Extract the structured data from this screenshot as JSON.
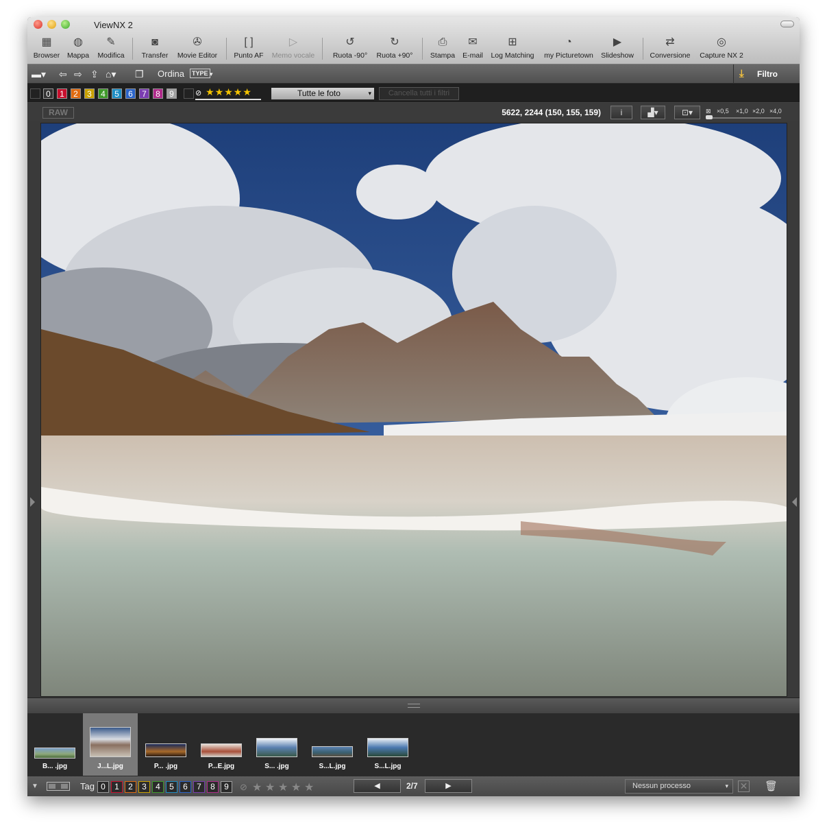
{
  "window": {
    "title": "ViewNX 2"
  },
  "toolbar": {
    "items": [
      {
        "label": "Browser",
        "icon": "browser-icon"
      },
      {
        "label": "Mappa",
        "icon": "globe-icon"
      },
      {
        "label": "Modifica",
        "icon": "edit-icon"
      },
      {
        "label": "Transfer",
        "icon": "camera-icon"
      },
      {
        "label": "Movie Editor",
        "icon": "film-reel-icon"
      },
      {
        "label": "Punto AF",
        "icon": "af-point-icon"
      },
      {
        "label": "Memo vocale",
        "icon": "voice-memo-icon",
        "disabled": true
      },
      {
        "label": "Ruota -90°",
        "icon": "rotate-left-icon"
      },
      {
        "label": "Ruota +90°",
        "icon": "rotate-right-icon"
      },
      {
        "label": "Stampa",
        "icon": "print-icon"
      },
      {
        "label": "E-mail",
        "icon": "mail-icon"
      },
      {
        "label": "Log Matching",
        "icon": "log-matching-icon"
      },
      {
        "label": "my Picturetown",
        "icon": "picturetown-icon"
      },
      {
        "label": "Slideshow",
        "icon": "slideshow-icon"
      },
      {
        "label": "Conversione",
        "icon": "convert-icon"
      },
      {
        "label": "Capture NX 2",
        "icon": "capture-nx-icon"
      }
    ]
  },
  "navbar": {
    "sort_label": "Ordina",
    "sort_type": "TYPE",
    "filter_label": "Filtro"
  },
  "filterbar": {
    "labels": [
      "0",
      "1",
      "2",
      "3",
      "4",
      "5",
      "6",
      "7",
      "8",
      "9"
    ],
    "label_colors": [
      "#333333",
      "#c8102e",
      "#e06a10",
      "#c9a100",
      "#3f9a2a",
      "#1e8ec4",
      "#2a63c8",
      "#7a3cb0",
      "#b02a8a",
      "#a0a0a0"
    ],
    "stars": "★★★★★",
    "dropdown_value": "Tutte le foto",
    "clear_button": "Cancella tutti i filtri"
  },
  "infobar": {
    "raw_badge": "RAW",
    "coords": "5622, 2244 (150, 155, 159)",
    "zoom_levels": [
      "×0,5",
      "×1,0",
      "×2,0",
      "×4,0"
    ]
  },
  "filmstrip": {
    "items": [
      {
        "label": "B... .jpg",
        "selected": false
      },
      {
        "label": "J...L.jpg",
        "selected": true
      },
      {
        "label": "P... .jpg",
        "selected": false
      },
      {
        "label": "P...E.jpg",
        "selected": false
      },
      {
        "label": "S... .jpg",
        "selected": false
      },
      {
        "label": "S...L.jpg",
        "selected": false
      },
      {
        "label": "S...L.jpg",
        "selected": false
      }
    ]
  },
  "bottombar": {
    "tag_label": "Tag",
    "labels": [
      "0",
      "1",
      "2",
      "3",
      "4",
      "5",
      "6",
      "7",
      "8",
      "9"
    ],
    "page": "2/7",
    "prev": "◀",
    "next": "▶",
    "process": "Nessun processo"
  },
  "colors": {
    "accent_star": "#f5c400",
    "frame": "#3a3a3a"
  }
}
